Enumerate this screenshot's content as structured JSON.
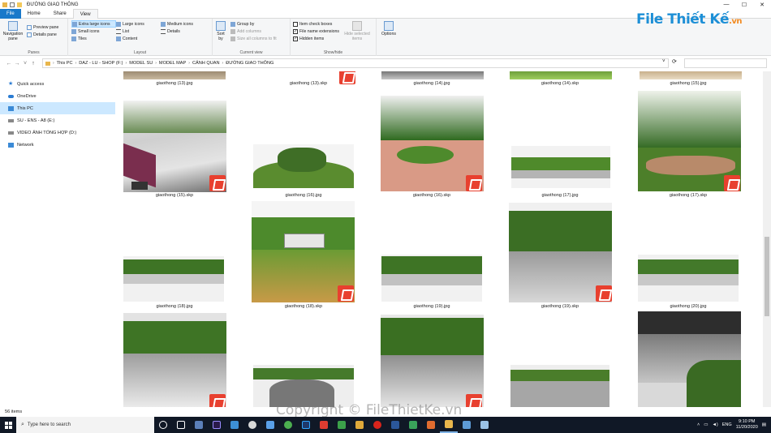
{
  "window": {
    "title": "ĐƯỜNG GIAO THÔNG"
  },
  "tabs": [
    "File",
    "Home",
    "Share",
    "View"
  ],
  "ribbon": {
    "panes": {
      "nav_pane": "Navigation pane",
      "preview": "Preview pane",
      "details": "Details pane",
      "label": "Panes"
    },
    "layout": {
      "items": [
        "Extra large icons",
        "Large icons",
        "Medium icons",
        "Small icons",
        "List",
        "Details",
        "Tiles",
        "Content"
      ],
      "label": "Layout"
    },
    "current_view": {
      "sort": "Sort by",
      "group": "Group by",
      "add_columns": "Add columns",
      "size_cols": "Size all columns to fit",
      "label": "Current view"
    },
    "show_hide": {
      "item_check": "Item check boxes",
      "file_ext": "File name extensions",
      "hidden": "Hidden items",
      "hide_selected": "Hide selected items",
      "label": "Show/hide"
    },
    "options": "Options"
  },
  "logo": {
    "text": "File Thiết Kế",
    "suffix": ".vn"
  },
  "address": {
    "crumbs": [
      "This PC",
      "DAZ - LU - SHOP (F:)",
      "MODEL SU",
      "MODEL MAP",
      "CẢNH QUAN",
      "ĐƯỜNG GIAO THÔNG"
    ]
  },
  "sidebar": {
    "items": [
      {
        "label": "Quick access",
        "icon": "star-icon"
      },
      {
        "label": "OneDrive",
        "icon": "cloud-icon"
      },
      {
        "label": "This PC",
        "icon": "computer-icon"
      },
      {
        "label": "SU - ENS - A8 (E:)",
        "icon": "drive-icon"
      },
      {
        "label": "VIDEO ẢNH TỔNG HỢP (D:)",
        "icon": "drive-icon"
      },
      {
        "label": "Network",
        "icon": "network-icon"
      }
    ]
  },
  "files": {
    "row0": [
      "giaothong (13).jpg",
      "giaothong (13).skp",
      "giaothong (14).jpg",
      "giaothong (14).skp",
      "giaothong (15).jpg"
    ],
    "row1": [
      "giaothong (15).skp",
      "giaothong (16).jpg",
      "giaothong (16).skp",
      "giaothong (17).jpg",
      "giaothong (17).skp"
    ],
    "row2": [
      "giaothong (18).jpg",
      "giaothong (18).skp",
      "giaothong (19).jpg",
      "giaothong (19).skp",
      "giaothong (20).jpg"
    ]
  },
  "status": {
    "count": "56 items"
  },
  "watermark": "Copyright © FileThietKe.vn",
  "taskbar": {
    "search_placeholder": "Type here to search",
    "lang": "ENG",
    "time": "9:10 PM",
    "date": "11/20/2020"
  }
}
